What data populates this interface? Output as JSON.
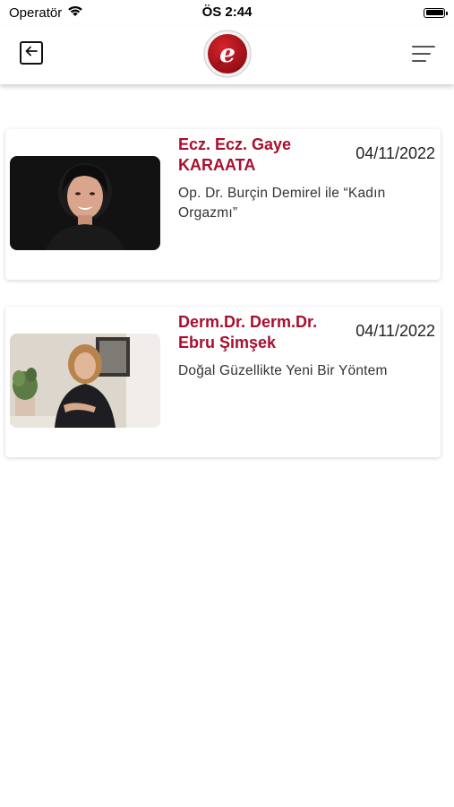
{
  "status_bar": {
    "carrier": "Operatör",
    "time": "ÖS 2:44",
    "icons": [
      "wifi-icon",
      "battery-icon"
    ]
  },
  "header": {
    "logo_letter": "e",
    "icons": [
      "back-arrow-icon",
      "menu-lines-icon"
    ],
    "brand_color": "#b5121b"
  },
  "articles": [
    {
      "author": "Ecz. Ecz. Gaye KARAATA",
      "date": "04/11/2022",
      "title": "Op. Dr. Burçin Demirel ile “Kadın Orgazmı”"
    },
    {
      "author": "Derm.Dr. Derm.Dr. Ebru Şimşek",
      "date": "04/11/2022",
      "title": "Doğal Güzellikte Yeni Bir Yöntem"
    }
  ],
  "colors": {
    "accent": "#a80f2e",
    "text": "#333333",
    "background": "#ffffff"
  }
}
